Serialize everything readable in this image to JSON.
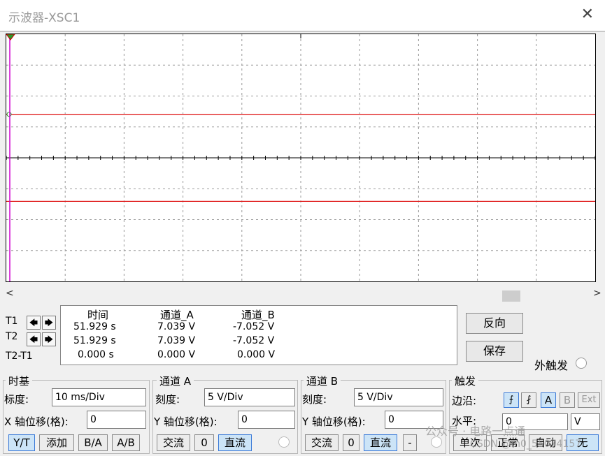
{
  "window": {
    "title": "示波器-XSC1",
    "close_label": "✕"
  },
  "scope": {
    "grid_cols": 10,
    "grid_rows": 8,
    "trace_color": "#e02020",
    "cursor_color": "#d000d0",
    "chart_data": {
      "type": "line",
      "series": [
        {
          "values": [
            7.039,
            7.039
          ]
        },
        {
          "values": [
            -7.052,
            -7.052
          ]
        }
      ],
      "ylim": [
        -20,
        20
      ],
      "volts_per_div": 5
    }
  },
  "scroll": {
    "left": "<",
    "right": ">"
  },
  "cursors": {
    "t1_label": "T1",
    "t2_label": "T2",
    "t2t1_label": "T2-T1",
    "left_arrow": "🡄",
    "right_arrow": "🡆"
  },
  "readout": {
    "headers": [
      "时间",
      "通道_A",
      "通道_B"
    ],
    "rows": [
      [
        "51.929 s",
        "7.039 V",
        "-7.052 V"
      ],
      [
        "51.929 s",
        "7.039 V",
        "-7.052 V"
      ],
      [
        "0.000 s",
        "0.000 V",
        "0.000 V"
      ]
    ]
  },
  "right_panel": {
    "reverse": "反向",
    "save": "保存",
    "ext_trigger": "外触发"
  },
  "timebase": {
    "title": "时基",
    "scale_label": "标度:",
    "scale_value": "10 ms/Div",
    "xpos_label": "X 轴位移(格):",
    "xpos_value": "0",
    "modes": [
      "Y/T",
      "添加",
      "B/A",
      "A/B"
    ]
  },
  "channel_a": {
    "title": "通道 A",
    "scale_label": "刻度:",
    "scale_value": "5  V/Div",
    "ypos_label": "Y 轴位移(格):",
    "ypos_value": "0",
    "coupling": [
      "交流",
      "0",
      "直流"
    ]
  },
  "channel_b": {
    "title": "通道 B",
    "scale_label": "刻度:",
    "scale_value": "5  V/Div",
    "ypos_label": "Y 轴位移(格):",
    "ypos_value": "0",
    "coupling": [
      "交流",
      "0",
      "直流",
      "-"
    ]
  },
  "trigger": {
    "title": "触发",
    "edge_label": "边沿:",
    "level_label": "水平:",
    "level_value": "0",
    "level_unit": "V",
    "sources": [
      "A",
      "B",
      "Ext"
    ],
    "modes": [
      "单次",
      "正常",
      "自动",
      "无"
    ]
  },
  "watermark": {
    "text1": "公众号 · 电路一点通",
    "text2": "CSDN @m0_55074157"
  }
}
